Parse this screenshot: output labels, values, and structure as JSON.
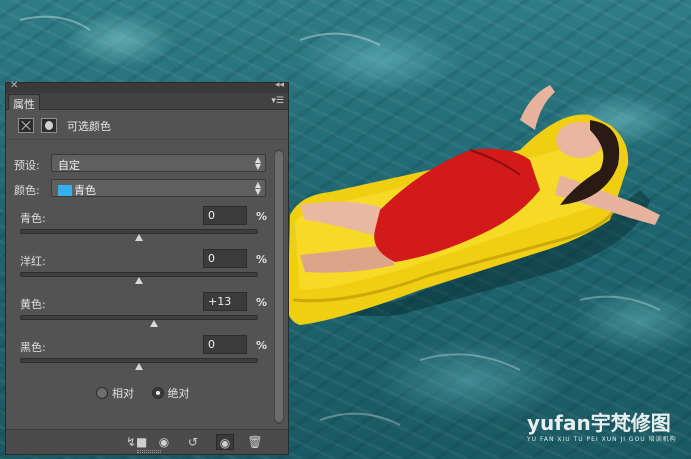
{
  "panel": {
    "tab_label": "属性",
    "adjustment_title": "可选颜色",
    "header_icons": [
      "adjustment-layer-icon",
      "layer-mask-icon"
    ],
    "preset": {
      "label": "预设:",
      "value": "自定"
    },
    "colors": {
      "label": "颜色:",
      "value": "青色",
      "swatch_color": "#31b1f0"
    },
    "sliders": [
      {
        "label": "青色:",
        "value": "0",
        "unit": "%"
      },
      {
        "label": "洋红:",
        "value": "0",
        "unit": "%"
      },
      {
        "label": "黄色:",
        "value": "+13",
        "unit": "%"
      },
      {
        "label": "黑色:",
        "value": "0",
        "unit": "%"
      }
    ],
    "method": {
      "relative": "相对",
      "absolute": "绝对",
      "selected": "absolute"
    },
    "footer_icons": [
      "clip-to-layer-icon",
      "view-previous-state-icon",
      "reset-icon",
      "visibility-eye-icon",
      "trash-icon"
    ]
  },
  "watermark": {
    "brand": "yufan宇梵修图",
    "tagline": "YU FAN XIU TU PEI XUN JI GOU 培训机构"
  }
}
